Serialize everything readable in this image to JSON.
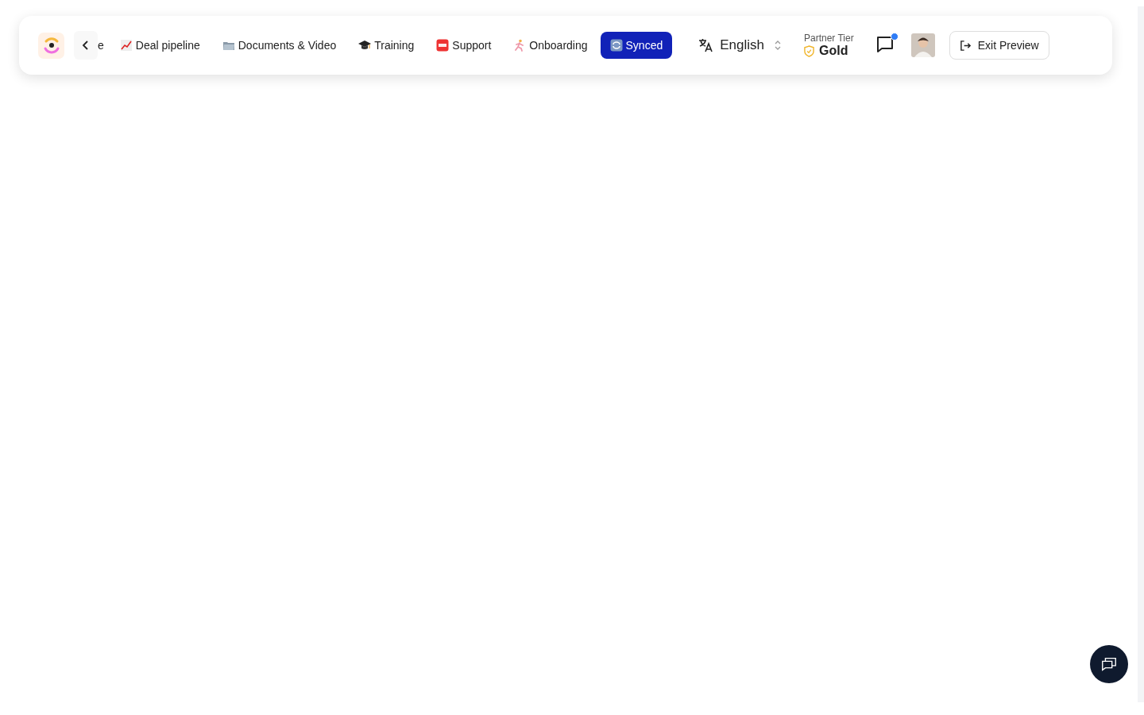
{
  "nav": {
    "tabs": [
      {
        "label": "e",
        "kind": "plain",
        "selected": false
      },
      {
        "label": "Deal pipeline",
        "kind": "chart",
        "selected": false
      },
      {
        "label": "Documents & Video",
        "kind": "folder",
        "selected": false
      },
      {
        "label": "Training",
        "kind": "cap",
        "selected": false
      },
      {
        "label": "Support",
        "kind": "sos",
        "selected": false
      },
      {
        "label": "Onboarding",
        "kind": "runner",
        "selected": false
      },
      {
        "label": "Synced",
        "kind": "sync",
        "selected": true
      }
    ]
  },
  "language": {
    "value": "English"
  },
  "tier": {
    "label": "Partner Tier",
    "value": "Gold"
  },
  "messages": {
    "unread": true
  },
  "exit_button": {
    "label": "Exit Preview"
  }
}
